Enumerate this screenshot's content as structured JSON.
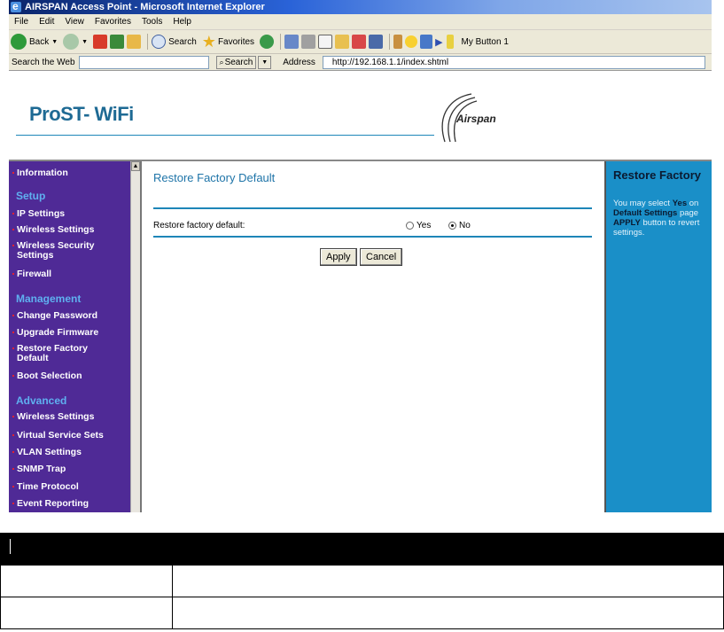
{
  "window": {
    "title": "AIRSPAN Access Point - Microsoft Internet Explorer"
  },
  "menu": [
    "File",
    "Edit",
    "View",
    "Favorites",
    "Tools",
    "Help"
  ],
  "toolbar": {
    "back": "Back",
    "search": "Search",
    "favorites": "Favorites",
    "my_button": "My Button 1"
  },
  "addressbar": {
    "search_web_label": "Search the Web",
    "search_button": "Search",
    "address_label": "Address",
    "url": "http://192.168.1.1/index.shtml"
  },
  "header": {
    "product": "ProST- WiFi",
    "brand": "Airspan"
  },
  "sidebar": {
    "top_item": "Information",
    "sections": [
      {
        "title": "Setup",
        "items": [
          "IP Settings",
          "Wireless Settings",
          "Wireless Security Settings",
          "Firewall"
        ]
      },
      {
        "title": "Management",
        "items": [
          "Change Password",
          "Upgrade Firmware",
          "Restore Factory Default",
          "Boot Selection"
        ]
      },
      {
        "title": "Advanced",
        "items": [
          "Wireless Settings",
          "Virtual Service Sets",
          "VLAN Settings",
          "SNMP Trap",
          "Time Protocol",
          "Event Reporting"
        ]
      }
    ]
  },
  "main": {
    "title": "Restore Factory Default",
    "label": "Restore factory default:",
    "options": [
      "Yes",
      "No"
    ],
    "selected": "No",
    "apply": "Apply",
    "cancel": "Cancel"
  },
  "help": {
    "title": "Restore Factory",
    "text1": "You may select ",
    "bold1": "Yes",
    "text2": " on",
    "bold2": "Default Settings",
    "text3": " page",
    "bold3": "APPLY",
    "text4": " button to revert",
    "text5": "settings."
  },
  "colors": {
    "sidebar": "#4f2a96",
    "help": "#1a8fc8",
    "accent": "#1e86b8"
  }
}
